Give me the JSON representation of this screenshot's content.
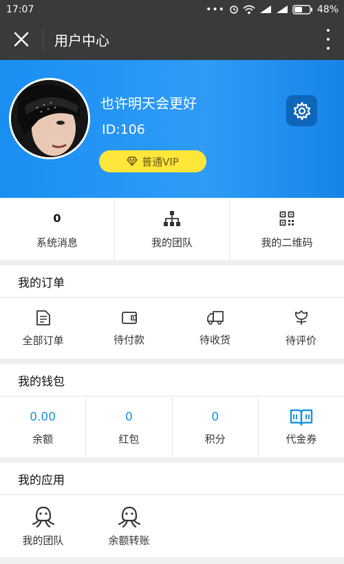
{
  "status_bar": {
    "time": "17:07",
    "battery": "48%"
  },
  "title_bar": {
    "title": "用户中心"
  },
  "profile": {
    "username": "也许明天会更好",
    "id_text": "ID:106",
    "vip_label": "普通VIP"
  },
  "quick_links": [
    {
      "value": "0",
      "label": "系统消息"
    },
    {
      "icon": "org-chart-icon",
      "label": "我的团队"
    },
    {
      "icon": "qr-code-icon",
      "label": "我的二维码"
    }
  ],
  "orders": {
    "title": "我的订单",
    "items": [
      {
        "icon": "document-icon",
        "label": "全部订单"
      },
      {
        "icon": "wallet-icon",
        "label": "待付款"
      },
      {
        "icon": "truck-icon",
        "label": "待收货"
      },
      {
        "icon": "flower-icon",
        "label": "待评价"
      }
    ]
  },
  "wallet": {
    "title": "我的钱包",
    "items": [
      {
        "value": "0.00",
        "label": "余额"
      },
      {
        "value": "0",
        "label": "红包"
      },
      {
        "value": "0",
        "label": "积分"
      },
      {
        "icon": "book-icon",
        "label": "代金券"
      }
    ]
  },
  "apps": {
    "title": "我的应用",
    "items": [
      {
        "icon": "octopus-icon",
        "label": "我的团队"
      },
      {
        "icon": "octopus-icon",
        "label": "余额转账"
      }
    ]
  },
  "colors": {
    "accent_blue": "#1a8ff2",
    "vip_yellow": "#ffe63a",
    "settings_bg": "#0e66b8",
    "wallet_value": "#1a93e0",
    "dark_bar": "#3a3a3a"
  }
}
